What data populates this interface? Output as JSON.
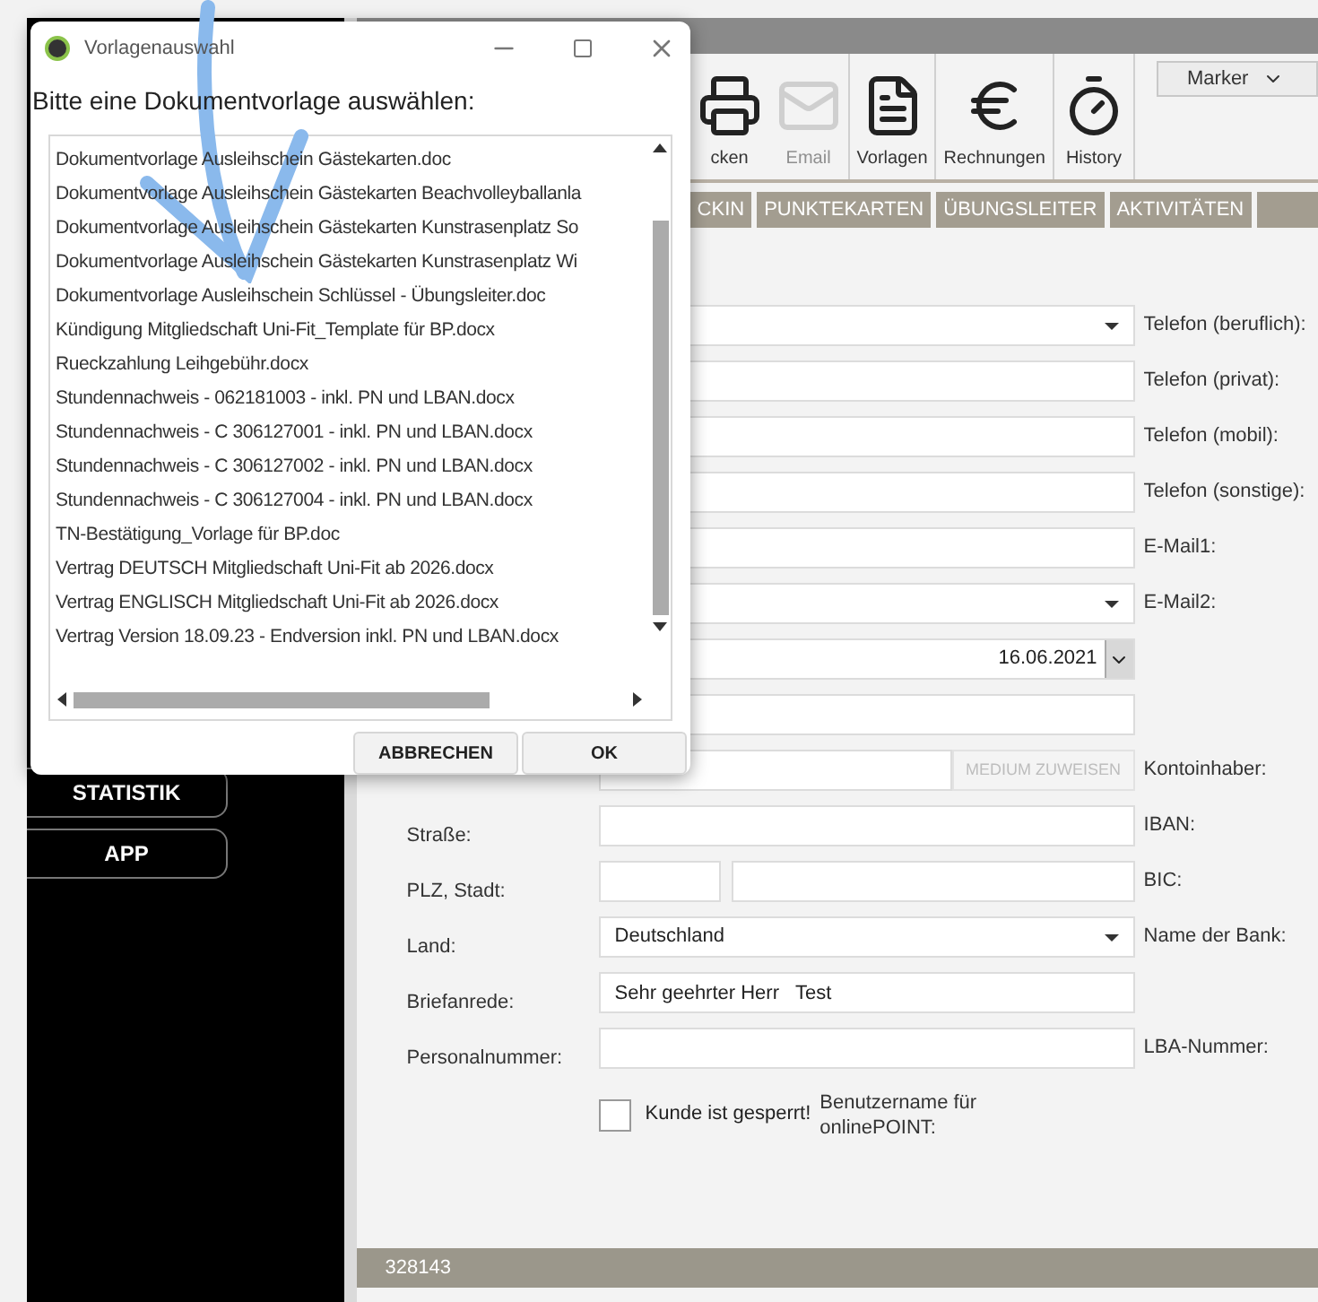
{
  "dialog": {
    "title": "Vorlagenauswahl",
    "prompt": "Bitte eine Dokumentvorlage auswählen:",
    "templates": [
      {
        "label": "Dokumentvorlage Ausleihschein Gästekarten.doc",
        "selected": false
      },
      {
        "label": "Dokumentvorlage Ausleihschein Gästekarten Beachvolleyballanla",
        "selected": false
      },
      {
        "label": "Dokumentvorlage Ausleihschein Gästekarten Kunstrasenplatz So",
        "selected": false
      },
      {
        "label": "Dokumentvorlage Ausleihschein Gästekarten Kunstrasenplatz Wi",
        "selected": false
      },
      {
        "label": "Dokumentvorlage Ausleihschein Schlüssel - Übungsleiter.doc",
        "selected": false
      },
      {
        "label": "Kündigung Mitgliedschaft Uni-Fit_Template für BP.docx",
        "selected": false
      },
      {
        "label": "Rueckzahlung Leihgebühr.docx",
        "selected": false
      },
      {
        "label": "Stundennachweis - 062181003 - inkl. PN und LBAN.docx",
        "selected": false
      },
      {
        "label": "Stundennachweis - C 306127001 - inkl. PN und LBAN.docx",
        "selected": false
      },
      {
        "label": "Stundennachweis - C 306127002 - inkl. PN und LBAN.docx",
        "selected": false
      },
      {
        "label": "Stundennachweis - C 306127004 - inkl. PN und LBAN.docx",
        "selected": false
      },
      {
        "label": "TN-Bestätigung_Vorlage für BP.doc",
        "selected": false
      },
      {
        "label": "Vertrag DEUTSCH Mitgliedschaft Uni-Fit ab 2026.docx",
        "selected": false
      },
      {
        "label": "Vertrag ENGLISCH Mitgliedschaft Uni-Fit ab 2026.docx",
        "selected": false
      },
      {
        "label": "Vertrag Version 18.09.23 - Endversion inkl. PN und LBAN.docx",
        "selected": false
      }
    ],
    "buttons": [
      "ABBRECHEN",
      "OK"
    ]
  },
  "toolbar": [
    {
      "kind": "print",
      "label": "cken",
      "disabled": false
    },
    {
      "kind": "email",
      "label": "Email",
      "disabled": true
    },
    {
      "kind": "word",
      "label": "Vorlagen",
      "disabled": false
    },
    {
      "kind": "euro",
      "label": "Rechnungen",
      "disabled": false
    },
    {
      "kind": "history",
      "label": "History",
      "disabled": false
    }
  ],
  "marker": {
    "value": "Marker"
  },
  "tabs": [
    {
      "label": "CKIN"
    },
    {
      "label": "PUNKTEKARTEN"
    },
    {
      "label": "ÜBUNGSLEITER"
    },
    {
      "label": "AKTIVITÄTEN"
    }
  ],
  "sidebar": {
    "buttons": [
      "STATISTIK",
      "APP"
    ]
  },
  "form": {
    "rows": [
      {
        "kind": "select",
        "value": "",
        "right": "Telefon (beruflich):"
      },
      {
        "kind": "text",
        "value": "",
        "right": "Telefon (privat):"
      },
      {
        "kind": "text",
        "value": "",
        "right": "Telefon (mobil):"
      },
      {
        "kind": "text",
        "value": "",
        "right": "Telefon (sonstige):"
      },
      {
        "kind": "text",
        "value": "",
        "right": "E-Mail1:"
      },
      {
        "kind": "select",
        "value": "",
        "right": "E-Mail2:"
      },
      {
        "kind": "date",
        "value": "16.06.2021"
      },
      {
        "kind": "text",
        "value": ""
      },
      {
        "kind": "medium",
        "value": "",
        "button": "MEDIUM ZUWEISEN",
        "right": "Kontoinhaber:"
      },
      {
        "kind": "text",
        "label": "Straße:",
        "value": "",
        "right": "IBAN:"
      },
      {
        "kind": "zip",
        "label": "PLZ, Stadt:",
        "value": "",
        "right": "BIC:"
      },
      {
        "kind": "select",
        "label": "Land:",
        "value": "Deutschland",
        "right": "Name der Bank:"
      },
      {
        "kind": "text",
        "label": "Briefanrede:",
        "value": "Sehr geehrter Herr   Test"
      },
      {
        "kind": "text",
        "label": "Personalnummer:",
        "value": "",
        "right": "LBA-Nummer:"
      },
      {
        "kind": "checkbox",
        "text": "Kunde ist gesperrt!",
        "checked": false,
        "right": "Benutzername für onlinePOINT:"
      }
    ]
  },
  "status_bar": {
    "text": "328143"
  }
}
